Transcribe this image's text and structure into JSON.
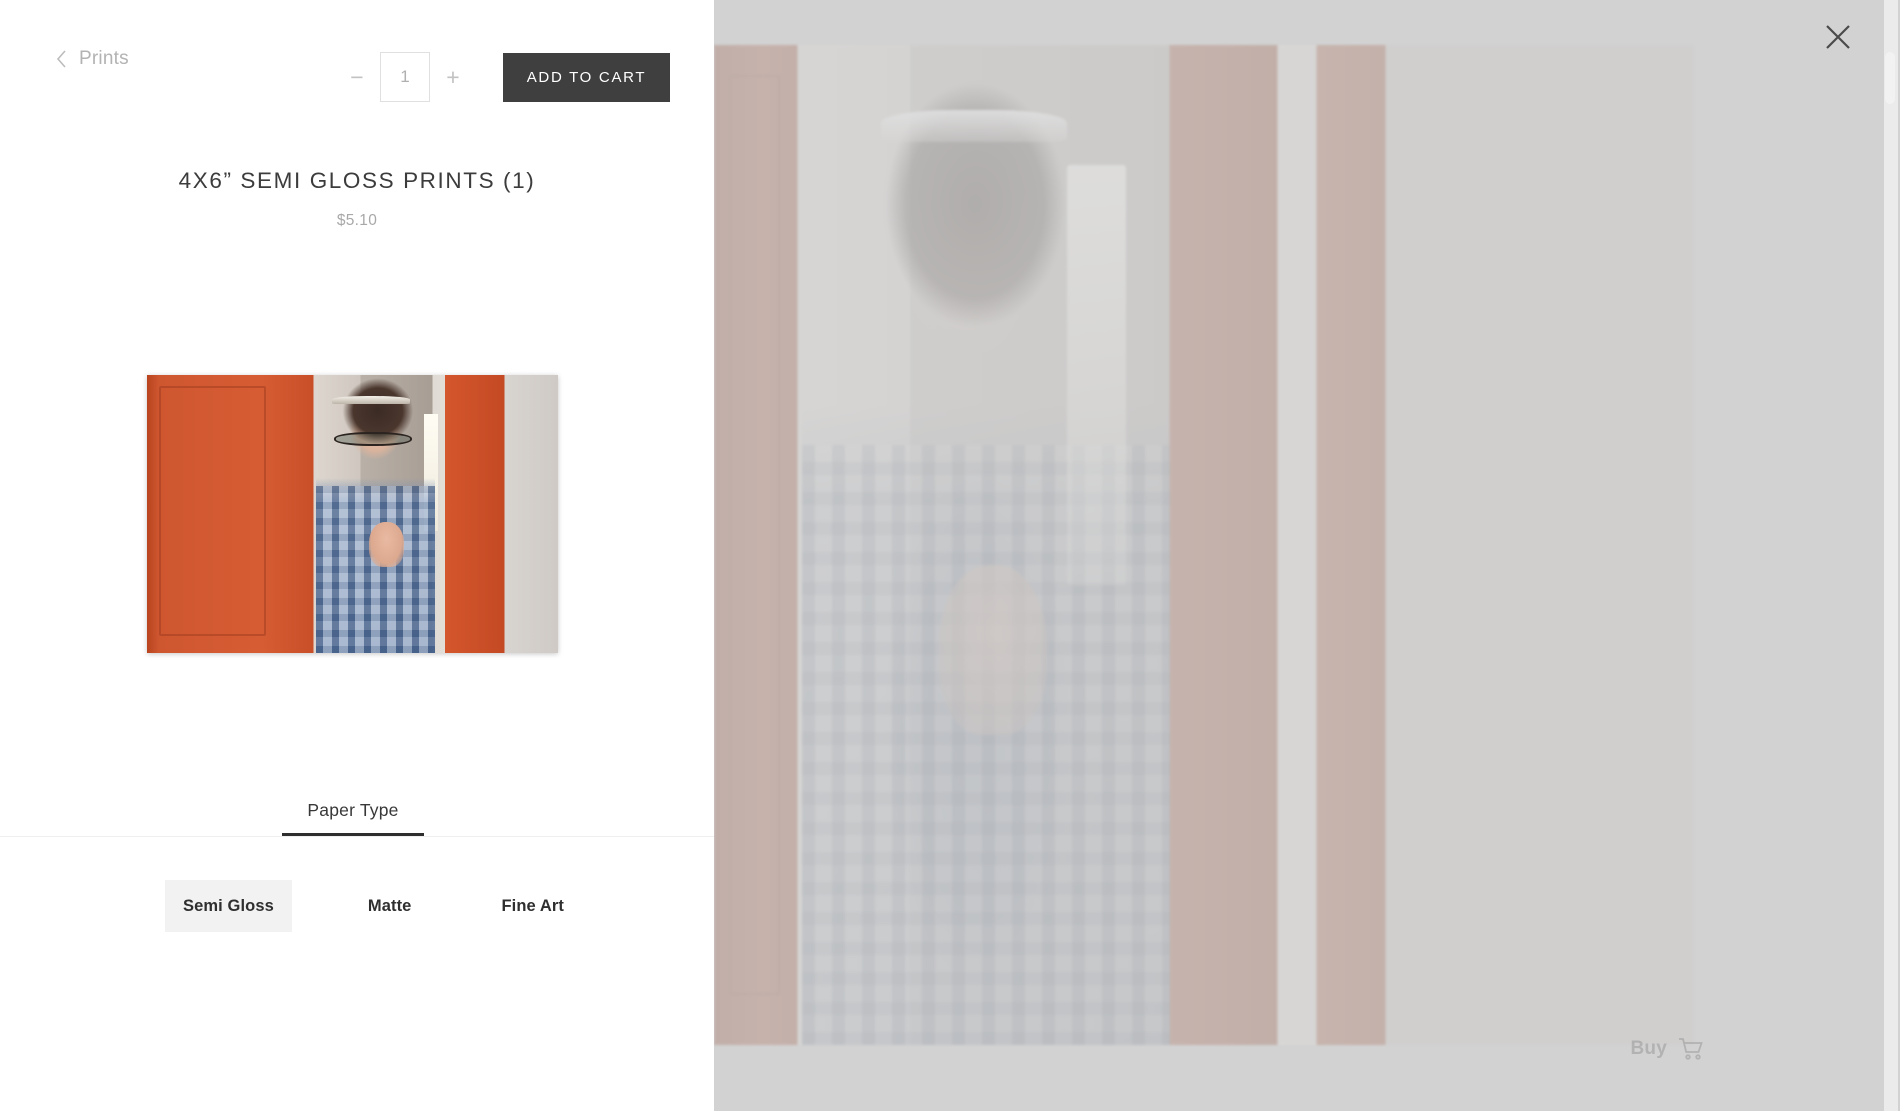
{
  "window": {
    "background_color": "#d2d2d2",
    "panel_background": "#ffffff"
  },
  "close_button": {
    "icon": "close-icon",
    "label": "Close"
  },
  "scrollbar": {
    "thumb_color": "#f2f2f2"
  },
  "header": {
    "back_icon": "chevron-left-icon",
    "back_label": "Prints"
  },
  "quantity": {
    "minus_label": "−",
    "plus_label": "+",
    "value": "1",
    "placeholder": "1"
  },
  "cart": {
    "add_label": "ADD TO CART",
    "button_color": "#3f3f3f"
  },
  "product": {
    "title": "4X6” SEMI GLOSS PRINTS (1)",
    "price": "$5.10"
  },
  "preview": {
    "thumbnail_alt": "Woman with glasses and tiara peeking around an orange door",
    "background_alt": "Faded preview of the same photograph"
  },
  "tabs": [
    {
      "label": "Paper Type",
      "active": true
    }
  ],
  "options": {
    "group": "Paper Type",
    "items": [
      {
        "label": "Semi Gloss",
        "selected": true
      },
      {
        "label": "Matte",
        "selected": false
      },
      {
        "label": "Fine Art",
        "selected": false
      }
    ]
  },
  "buy_badge": {
    "label": "Buy",
    "icon": "shopping-cart-icon"
  }
}
